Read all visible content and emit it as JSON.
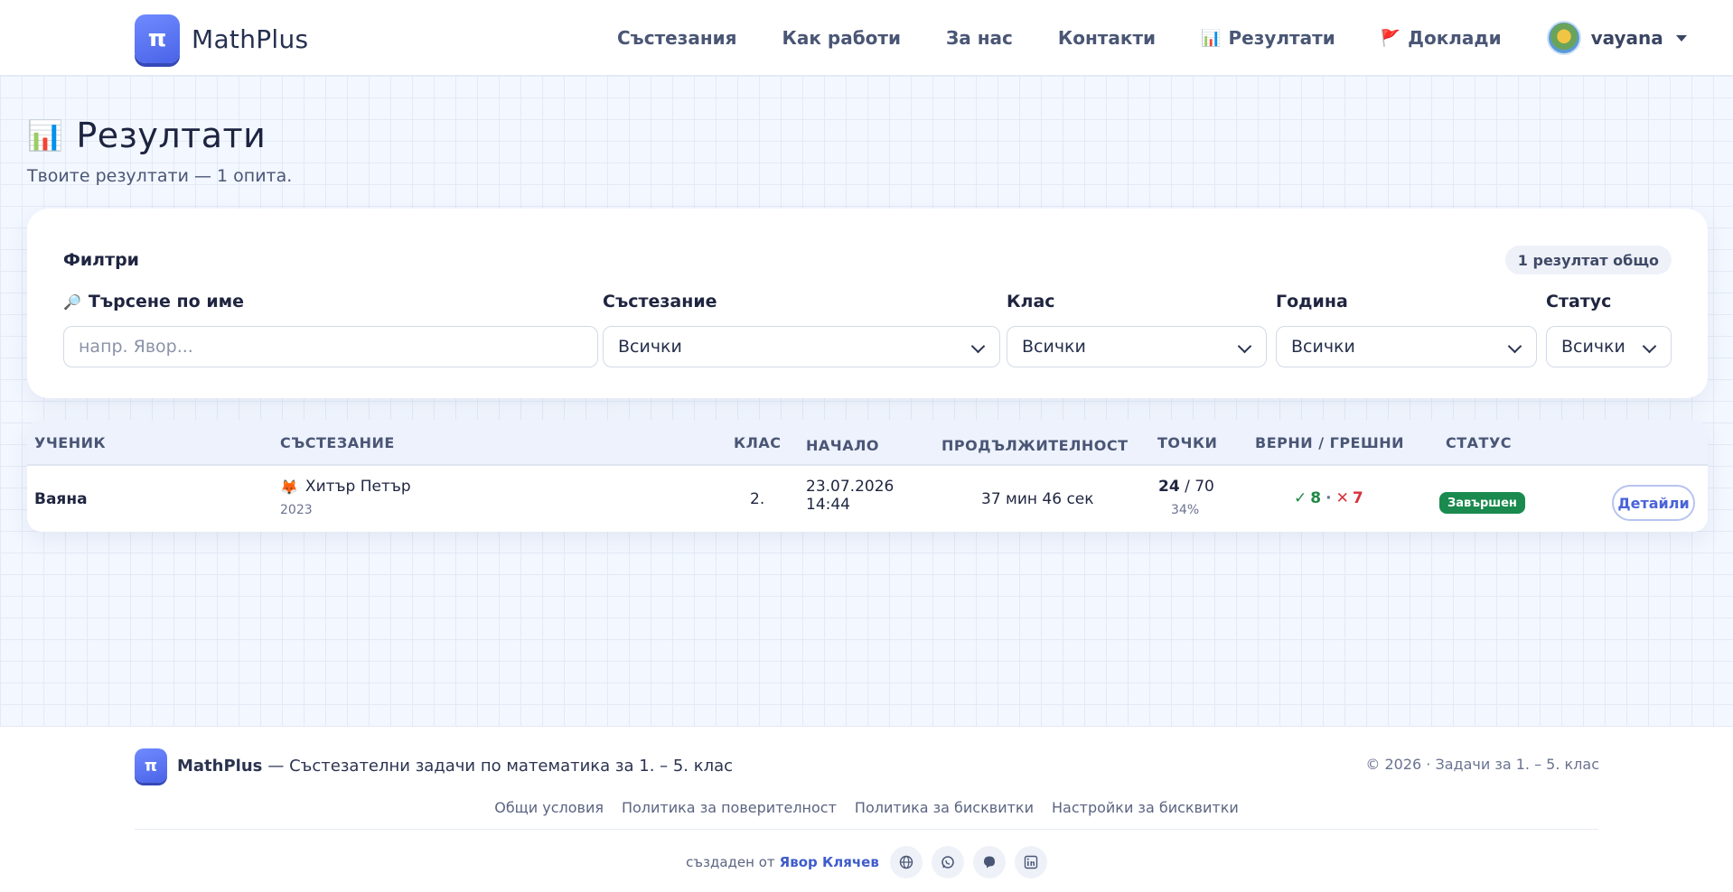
{
  "header": {
    "logo_symbol": "π",
    "logo_text": "MathPlus",
    "nav": [
      {
        "label": "Състезания",
        "icon": ""
      },
      {
        "label": "Как работи",
        "icon": ""
      },
      {
        "label": "За нас",
        "icon": ""
      },
      {
        "label": "Контакти",
        "icon": ""
      },
      {
        "label": "Резултати",
        "icon": "📊"
      },
      {
        "label": "Доклади",
        "icon": "🚩"
      }
    ],
    "user": {
      "name": "vayana",
      "avatar": "turtle-avatar"
    }
  },
  "page": {
    "title_icon": "📊",
    "title": "Резултати",
    "subtitle": "Твоите резултати — 1 опита."
  },
  "filters": {
    "title": "Филтри",
    "total": "1 резултат общо",
    "search": {
      "icon": "🔎",
      "label": "Търсене по име",
      "placeholder": "напр. Явор..."
    },
    "competition": {
      "label": "Състезание",
      "value": "Всички"
    },
    "grade": {
      "label": "Клас",
      "value": "Всички"
    },
    "year": {
      "label": "Година",
      "value": "Всички"
    },
    "status": {
      "label": "Статус",
      "value": "Всички"
    }
  },
  "table": {
    "headers": [
      "УЧЕНИК",
      "СЪСТЕЗАНИЕ",
      "КЛАС",
      "НАЧАЛО",
      "ПРОДЪЛЖИТЕЛНОСТ",
      "ТОЧКИ",
      "ВЕРНИ / ГРЕШНИ",
      "СТАТУС"
    ],
    "rows": [
      {
        "student": "Ваяна",
        "competition_icon": "🦊",
        "competition": "Хитър Петър",
        "year": "2023",
        "grade": "2.",
        "start_date": "23.07.2026",
        "start_time": "14:44",
        "duration": "37 мин 46 сек",
        "points": "24",
        "points_max": "/ 70",
        "percent": "34%",
        "correct_mark": "✓",
        "correct": "8",
        "separator": "·",
        "wrong_mark": "✕",
        "wrong": "7",
        "status": "Завършен",
        "status_color": "#1a8a4e",
        "action": "Детайли"
      }
    ]
  },
  "footer": {
    "logo_symbol": "π",
    "brand": "MathPlus",
    "tagline": "— Състезателни задачи по математика за 1. – 5. клас",
    "copyright": "© 2026 · Задачи за 1. – 5. клас",
    "links": [
      "Общи условия",
      "Политика за поверителност",
      "Политика за бисквитки",
      "Настройки за бисквитки"
    ],
    "credit_prefix": "създаден от",
    "credit_name": "Явор Клячев",
    "social": [
      "globe-icon",
      "whatsapp-icon",
      "viber-icon",
      "linkedin-icon"
    ]
  },
  "colors": {
    "brand": "#4a63e8",
    "success": "#1f8a45",
    "danger": "#d7333b"
  }
}
